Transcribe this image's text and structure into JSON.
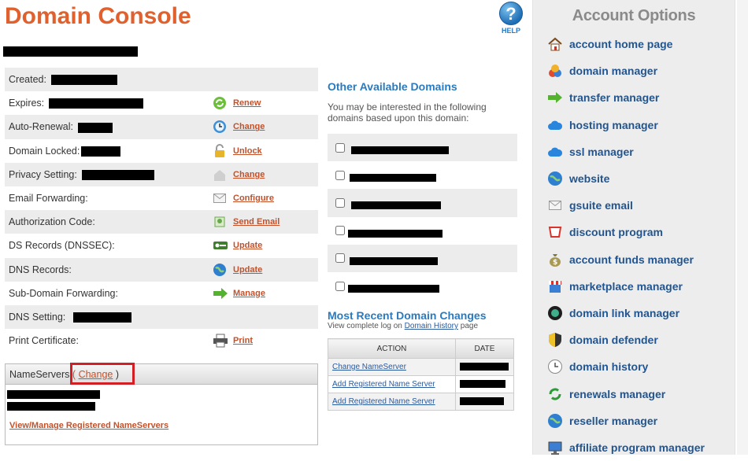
{
  "header": {
    "title": "Domain Console",
    "help_label": "HELP",
    "help_glyph": "?"
  },
  "details": [
    {
      "label": "Created:",
      "action": ""
    },
    {
      "label": "Expires:",
      "action": "Renew",
      "icon": "renew-icon"
    },
    {
      "label": "Auto-Renewal:",
      "action": "Change",
      "icon": "clock-icon"
    },
    {
      "label": "Domain Locked:",
      "action": "Unlock",
      "icon": "padlock-icon"
    },
    {
      "label": "Privacy Setting:",
      "action": "Change",
      "icon": "house-icon"
    },
    {
      "label": "Email Forwarding:",
      "action": "Configure",
      "icon": "envelope-icon"
    },
    {
      "label": "Authorization Code:",
      "action": "Send Email",
      "icon": "mail-send-icon"
    },
    {
      "label": "DS Records (DNSSEC):",
      "action": "Update",
      "icon": "key-icon"
    },
    {
      "label": "DNS Records:",
      "action": "Update",
      "icon": "globe-icon"
    },
    {
      "label": "Sub-Domain Forwarding:",
      "action": "Manage",
      "icon": "arrow-icon"
    },
    {
      "label": "DNS Setting:",
      "action": ""
    },
    {
      "label": "Print Certificate:",
      "action": "Print",
      "icon": "printer-icon"
    }
  ],
  "nameservers": {
    "label": "NameServers",
    "open": "(",
    "change": "Change",
    "close": ")",
    "manage_link": "View/Manage Registered NameServers"
  },
  "other_domains": {
    "title": "Other Available Domains",
    "description": "You may be interested in the following domains based upon this domain:",
    "count": 6
  },
  "recent_changes": {
    "title": "Most Recent Domain Changes",
    "sub_prefix": "View complete log on",
    "sub_link": "Domain History",
    "sub_suffix": "page",
    "headers": [
      "ACTION",
      "DATE"
    ],
    "rows": [
      "Change NameServer",
      "Add Registered Name Server",
      "Add Registered Name Server"
    ]
  },
  "sidebar": {
    "title": "Account Options",
    "items": [
      {
        "label": "account home page",
        "icon": "house-icon"
      },
      {
        "label": "domain manager",
        "icon": "domain-manager-icon"
      },
      {
        "label": "transfer manager",
        "icon": "green-arrow-icon"
      },
      {
        "label": "hosting manager",
        "icon": "cloud-icon"
      },
      {
        "label": "ssl manager",
        "icon": "cloud-icon"
      },
      {
        "label": "website",
        "icon": "globe-icon"
      },
      {
        "label": "gsuite email",
        "icon": "envelope-icon"
      },
      {
        "label": "discount program",
        "icon": "ticket-icon"
      },
      {
        "label": "account funds manager",
        "icon": "money-bag-icon"
      },
      {
        "label": "marketplace manager",
        "icon": "storefront-icon"
      },
      {
        "label": "domain link manager",
        "icon": "link-globe-icon"
      },
      {
        "label": "domain defender",
        "icon": "shield-icon"
      },
      {
        "label": "domain history",
        "icon": "clock-icon"
      },
      {
        "label": "renewals manager",
        "icon": "renew-icon"
      },
      {
        "label": "reseller manager",
        "icon": "globe-icon"
      },
      {
        "label": "affiliate program manager",
        "icon": "monitor-icon"
      }
    ]
  },
  "colors": {
    "title": "#e0612e",
    "link": "#c4512a",
    "blue_heading": "#2a7ac0",
    "sidebar_link": "#22558f",
    "highlight": "#d21f26"
  }
}
